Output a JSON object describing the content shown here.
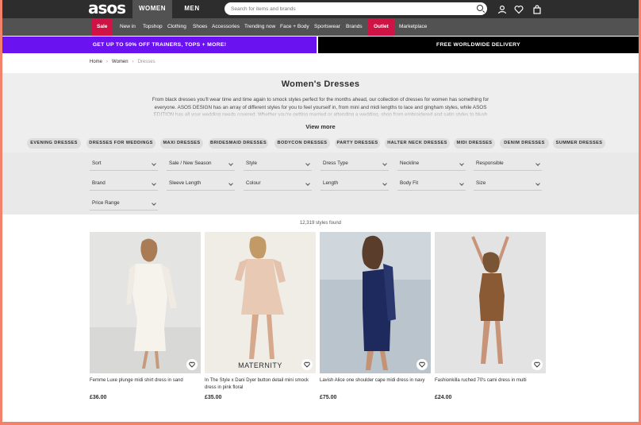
{
  "header": {
    "logo": "asos",
    "tabs": [
      "WOMEN",
      "MEN"
    ],
    "search_placeholder": "Search for items and brands",
    "icons": [
      "account-icon",
      "heart-icon",
      "bag-icon"
    ]
  },
  "nav": {
    "items": [
      "Sale",
      "New in",
      "Topshop",
      "Clothing",
      "Shoes",
      "Accessories",
      "Trending now",
      "Face + Body",
      "Sportswear",
      "Brands",
      "Outlet",
      "Marketplace"
    ]
  },
  "promo": {
    "left": "GET UP TO 50% OFF TRAINERS, TOPS + MORE!",
    "right": "FREE WORLDWIDE DELIVERY"
  },
  "breadcrumb": [
    "Home",
    "Women",
    "Dresses"
  ],
  "page": {
    "title": "Women's Dresses",
    "description": "From black dresses you'll wear time and time again to smock styles perfect for the months ahead, our collection of dresses for women has something for everyone. ASOS DESIGN has an array of different styles for you to feel yourself in, from mini and midi lengths to lace and gingham styles, while ASOS EDITION has all your wedding needs covered. Whether you're getting married or attending a wedding, shop from embroidered and satin styles to blush",
    "view_more": "View more"
  },
  "categories": [
    "EVENING DRESSES",
    "DRESSES FOR WEDDINGS",
    "MAXI DRESSES",
    "BRIDESMAID DRESSES",
    "BODYCON DRESSES",
    "PARTY DRESSES",
    "HALTER NECK DRESSES",
    "MIDI DRESSES",
    "DENIM DRESSES",
    "SUMMER DRESSES"
  ],
  "filters": [
    "Sort",
    "Sale / New Season",
    "Style",
    "Dress Type",
    "Neckline",
    "Responsible",
    "Brand",
    "Sleeve Length",
    "Colour",
    "Length",
    "Body Fit",
    "Size",
    "Price Range"
  ],
  "results_count": "12,319 styles found",
  "products": [
    {
      "name": "Femme Luxe plunge midi shirt dress in sand",
      "price": "£36.00"
    },
    {
      "name": "In The Style x Dani Dyer button detail mini smock dress in pink floral",
      "price": "£35.00",
      "badge": "MATERNITY"
    },
    {
      "name": "Lavish Alice one shoulder cape midi dress in navy",
      "price": "£75.00"
    },
    {
      "name": "Fashionkilla ruched 70's cami dress in multi",
      "price": "£24.00"
    }
  ],
  "colors": {
    "topbar": "#2d2d2d",
    "navbar": "#525252",
    "sale": "#d01345",
    "promo": "#6b12f0"
  }
}
